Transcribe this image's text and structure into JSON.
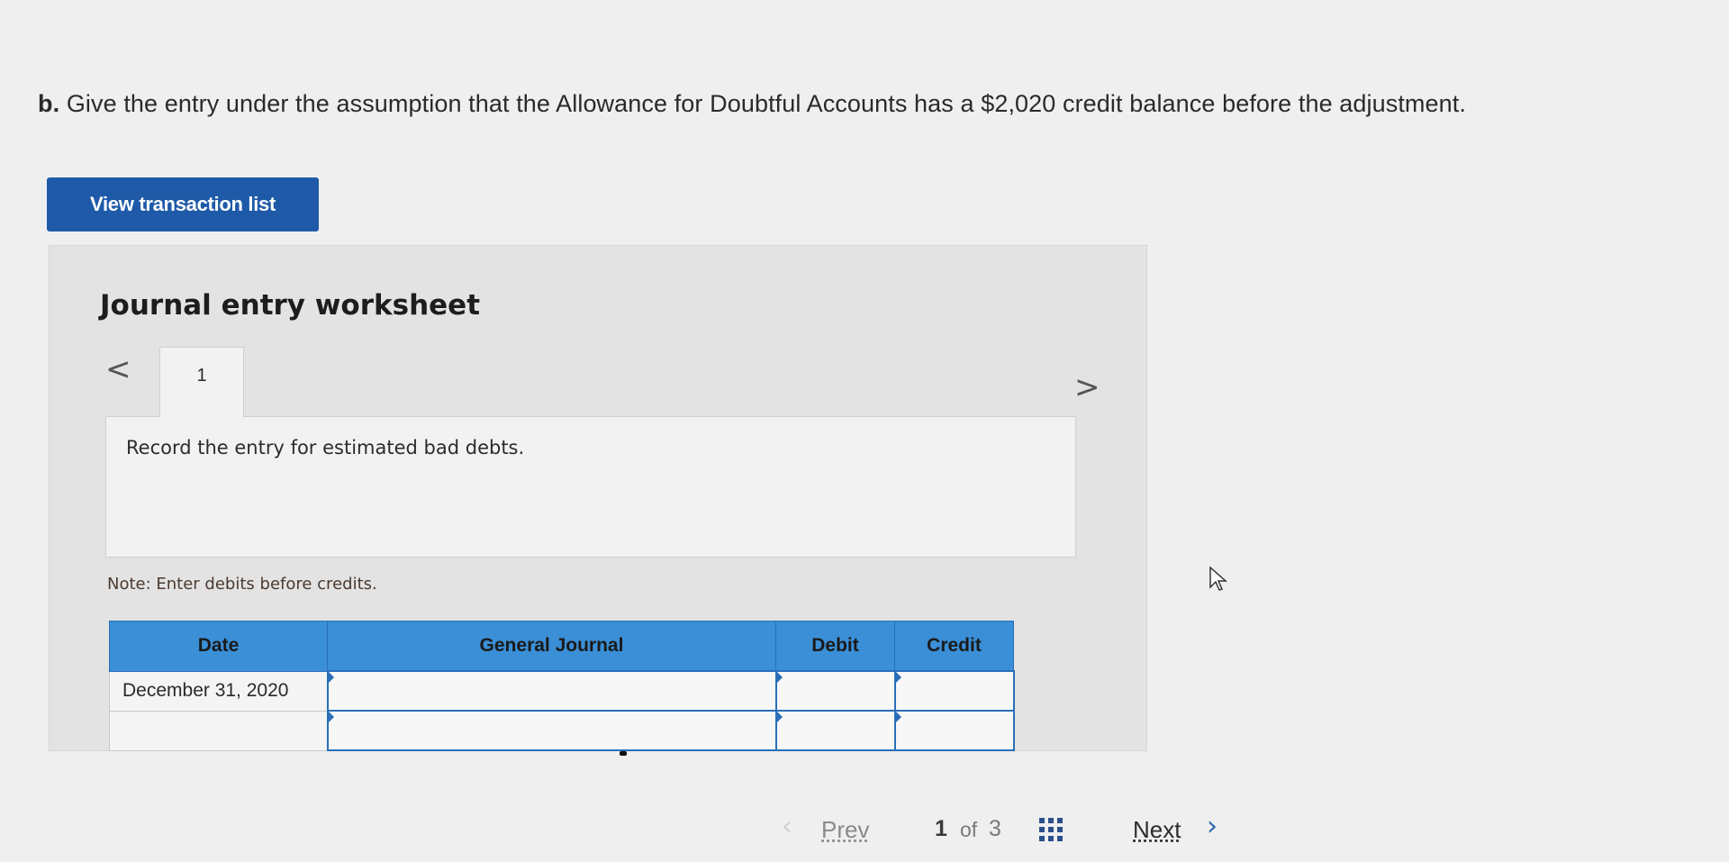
{
  "question": {
    "part": "b.",
    "text": "Give the entry under the assumption that the Allowance for Doubtful Accounts has a $2,020 credit balance before the adjustment."
  },
  "view_button_label": "View transaction list",
  "worksheet": {
    "title": "Journal entry worksheet",
    "current_tab": "1",
    "instruction": "Record the entry for estimated bad debts.",
    "note": "Note: Enter debits before credits.",
    "columns": [
      "Date",
      "General Journal",
      "Debit",
      "Credit"
    ],
    "rows": [
      {
        "date": "December 31, 2020",
        "account": "",
        "debit": "",
        "credit": ""
      },
      {
        "date": "",
        "account": "",
        "debit": "",
        "credit": ""
      }
    ]
  },
  "pager": {
    "prev_label": "Prev",
    "current_page": "1",
    "of_label": "of",
    "total_pages": "3",
    "next_label": "Next"
  },
  "colors": {
    "primary_button": "#1e5aa8",
    "table_header": "#3a8fd6",
    "input_border": "#2a6fb8"
  },
  "icons": {
    "prev_arrow": "chevron-left-icon",
    "next_arrow": "chevron-right-icon",
    "grid": "grid-icon",
    "pointer": "mouse-pointer-icon"
  }
}
